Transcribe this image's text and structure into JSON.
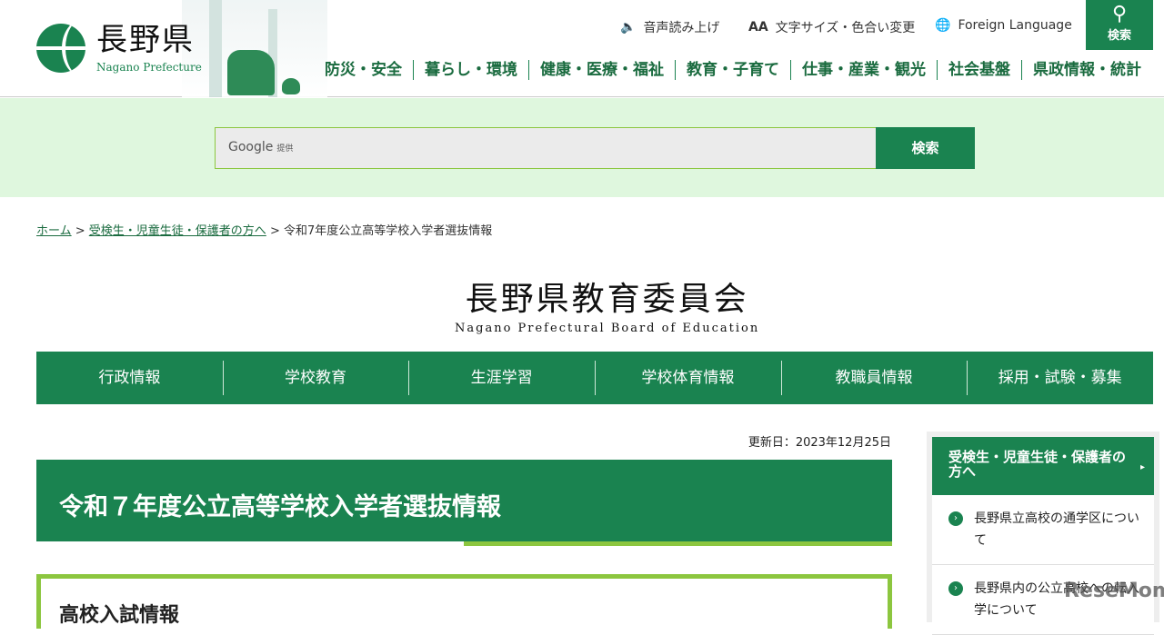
{
  "header": {
    "logo_jp": "長野県",
    "logo_en": "Nagano Prefecture",
    "utility": [
      {
        "icon": "speaker-icon",
        "label": "音声読み上げ"
      },
      {
        "icon": "font-size-icon",
        "label": "文字サイズ・色合い変更"
      },
      {
        "icon": "globe-icon",
        "label": "Foreign Language"
      }
    ],
    "search_label": "検索",
    "nav": [
      "防災・安全",
      "暮らし・環境",
      "健康・医療・福祉",
      "教育・子育て",
      "仕事・産業・観光",
      "社会基盤",
      "県政情報・統計"
    ]
  },
  "search": {
    "placeholder": "Google",
    "provided": "提供",
    "button": "検索"
  },
  "breadcrumb": [
    "ホーム",
    "受検生・児童生徒・保護者の方へ",
    "令和7年度公立高等学校入学者選抜情報"
  ],
  "board": {
    "jp": "長野県教育委員会",
    "en": "Nagano Prefectural Board of Education",
    "nav": [
      "行政情報",
      "学校教育",
      "生涯学習",
      "学校体育情報",
      "教職員情報",
      "採用・試験・募集"
    ]
  },
  "page": {
    "updated": "更新日：2023年12月25日",
    "title": "令和７年度公立高等学校入学者選抜情報",
    "section": "高校入試情報"
  },
  "sidebar": {
    "heading": "受検生・児童生徒・保護者の方へ",
    "items": [
      "長野県立高校の通学区について",
      "長野県内の公立高校への転入学について"
    ]
  },
  "watermark": "ReseMom"
}
